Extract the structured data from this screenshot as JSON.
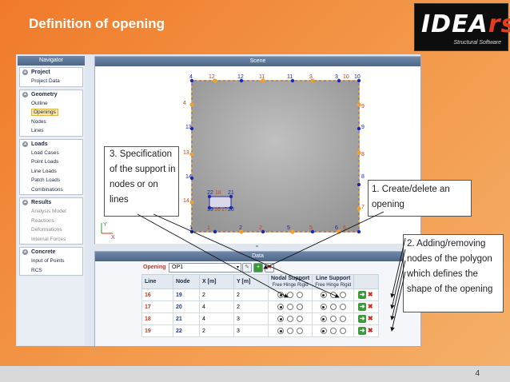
{
  "slide": {
    "title": "Definition of opening",
    "page_number": "4",
    "logo": {
      "word_main": "IDEA",
      "word_accent": "rs",
      "subtitle": "Structural Software"
    }
  },
  "navigator": {
    "title": "Navigator",
    "groups": [
      {
        "label": "Project",
        "items": [
          "Project Data"
        ]
      },
      {
        "label": "Geometry",
        "items": [
          "Outline",
          "Openings",
          "Nodes",
          "Lines"
        ],
        "active": "Openings"
      },
      {
        "label": "Loads",
        "items": [
          "Load Cases",
          "Point Loads",
          "Line Loads",
          "Patch Loads",
          "Combinations"
        ]
      },
      {
        "label": "Results",
        "items": [
          "Analysis Model",
          "Reactions",
          "Deformations",
          "Internal Forces"
        ]
      },
      {
        "label": "Concrete",
        "items": [
          "Input of Points",
          "RCS"
        ]
      }
    ]
  },
  "scene": {
    "title": "Scene",
    "axis_y": "Y",
    "axis_x": "X",
    "node_labels": [
      "4",
      "12",
      "12",
      "11",
      "11",
      "3",
      "3",
      "10",
      "10",
      "4",
      "9",
      "13",
      "9",
      "13",
      "8",
      "14",
      "8",
      "22",
      "18",
      "21",
      "14",
      "19",
      "16",
      "17",
      "20",
      "7",
      "1",
      "1",
      "2",
      "2",
      "5",
      "5",
      "6",
      "6"
    ]
  },
  "data_panel": {
    "title": "Data",
    "splitter": "=",
    "opening_label": "Opening",
    "opening_value": "OP1",
    "columns": [
      "Line",
      "Node",
      "X [m]",
      "Y [m]",
      "Nodal Support",
      "Line Support"
    ],
    "support_sub": "Free Hinge Rigid",
    "rows": [
      {
        "line": "16",
        "node": "19",
        "x": "2",
        "y": "2"
      },
      {
        "line": "17",
        "node": "20",
        "x": "4",
        "y": "2"
      },
      {
        "line": "18",
        "node": "21",
        "x": "4",
        "y": "3"
      },
      {
        "line": "19",
        "node": "22",
        "x": "2",
        "y": "3"
      }
    ]
  },
  "callouts": {
    "c1": "1. Create/delete an opening",
    "c2": "2. Adding/removing nodes of the polygon which defines the shape of the opening",
    "c3": "3. Specification of the support in nodes or on lines"
  },
  "colors": {
    "accent": "#f07a2a",
    "header": "#4d6688",
    "line_red": "#c23b22",
    "node_blue": "#1a3c9c"
  }
}
